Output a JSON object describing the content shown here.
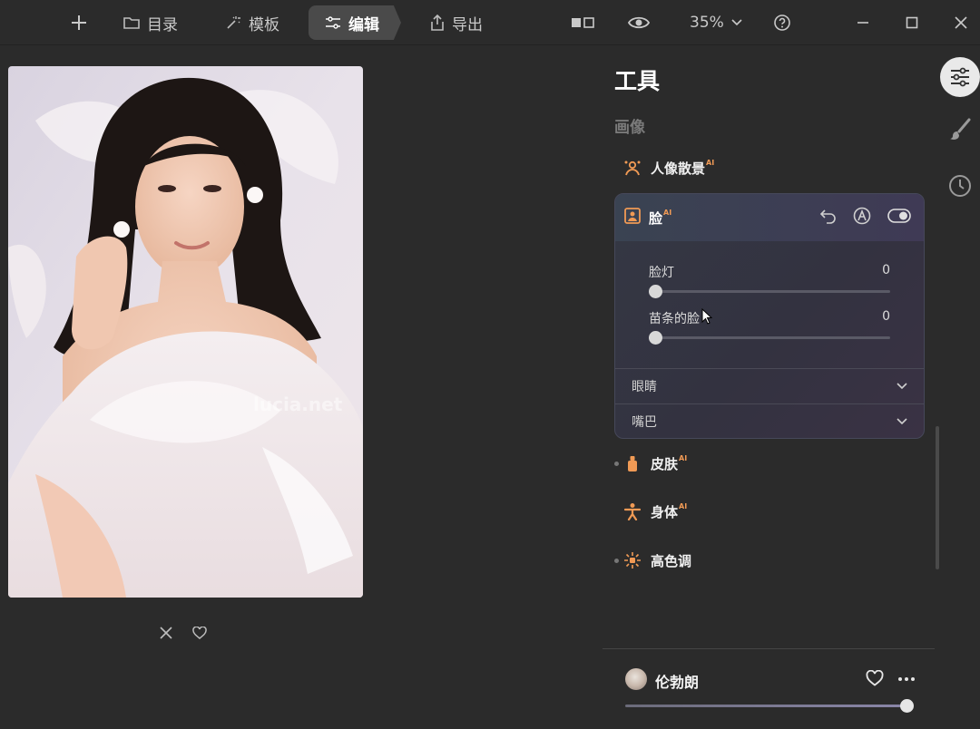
{
  "toolbar": {
    "catalog_label": "目录",
    "template_label": "模板",
    "edit_label": "编辑",
    "export_label": "导出",
    "zoom_value": "35%"
  },
  "panel": {
    "title": "工具",
    "section_label": "画像",
    "tools": [
      {
        "label": "人像散景",
        "ai_badge": "AI",
        "icon": "portrait-bokeh-icon"
      },
      {
        "label": "皮肤",
        "ai_badge": "AI",
        "icon": "skin-icon"
      },
      {
        "label": "身体",
        "ai_badge": "AI",
        "icon": "body-icon"
      },
      {
        "label": "高色调",
        "ai_badge": "",
        "icon": "high-key-icon"
      }
    ],
    "face": {
      "label": "脸",
      "ai_badge": "AI",
      "sliders": [
        {
          "label": "脸灯",
          "value": "0"
        },
        {
          "label": "苗条的脸",
          "value": "0"
        }
      ],
      "subsections": [
        {
          "label": "眼睛"
        },
        {
          "label": "嘴巴"
        }
      ]
    }
  },
  "preset": {
    "name": "伦勃朗",
    "strength": 1.0
  },
  "photo": {
    "watermark": "lucia.net"
  },
  "colors": {
    "accent_orange": "#f09a55",
    "background": "#2b2b2b",
    "card_border": "#46485a"
  }
}
